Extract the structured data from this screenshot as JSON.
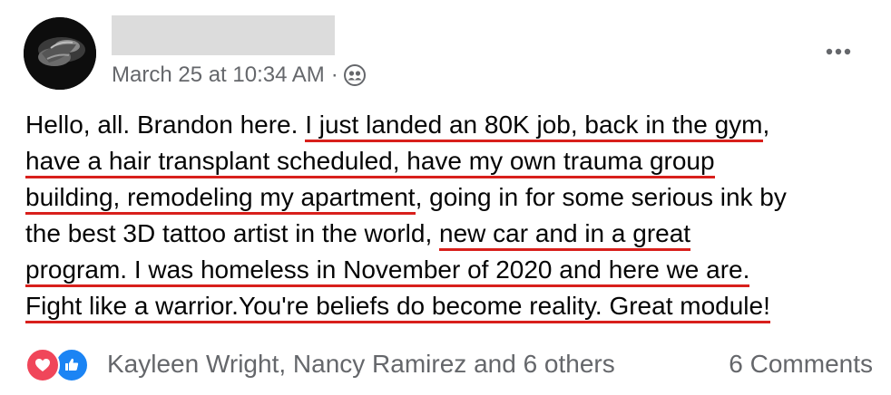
{
  "post": {
    "timestamp": "March 25 at 10:34 AM",
    "separator": "·",
    "audience_icon": "friends-icon",
    "more_icon": "more-options-icon",
    "lines": [
      [
        {
          "text": "Hello, all. Brandon here. ",
          "underline": false
        },
        {
          "text": "I just landed an 80K job, back in the gym",
          "underline": true
        },
        {
          "text": ",",
          "underline": false
        }
      ],
      [
        {
          "text": "have a hair transplant scheduled, have my own trauma group",
          "underline": true
        }
      ],
      [
        {
          "text": "building, remodeling my apartment",
          "underline": true
        },
        {
          "text": ", going in for some serious ink by",
          "underline": false
        }
      ],
      [
        {
          "text": "the best 3D tattoo artist in the world, ",
          "underline": false
        },
        {
          "text": "new car and in a great",
          "underline": true
        }
      ],
      [
        {
          "text": "program. I was homeless in November of 2020 and here we are.",
          "underline": true
        }
      ],
      [
        {
          "text": "Fight like a  warrior.You're beliefs do become reality. Great module!",
          "underline": true
        }
      ]
    ],
    "underline_color": "#d8201c"
  },
  "footer": {
    "reactions": [
      "love-icon",
      "like-icon"
    ],
    "reactors_text": "Kayleen Wright, Nancy Ramirez and 6 others",
    "comments_text": "6 Comments"
  }
}
